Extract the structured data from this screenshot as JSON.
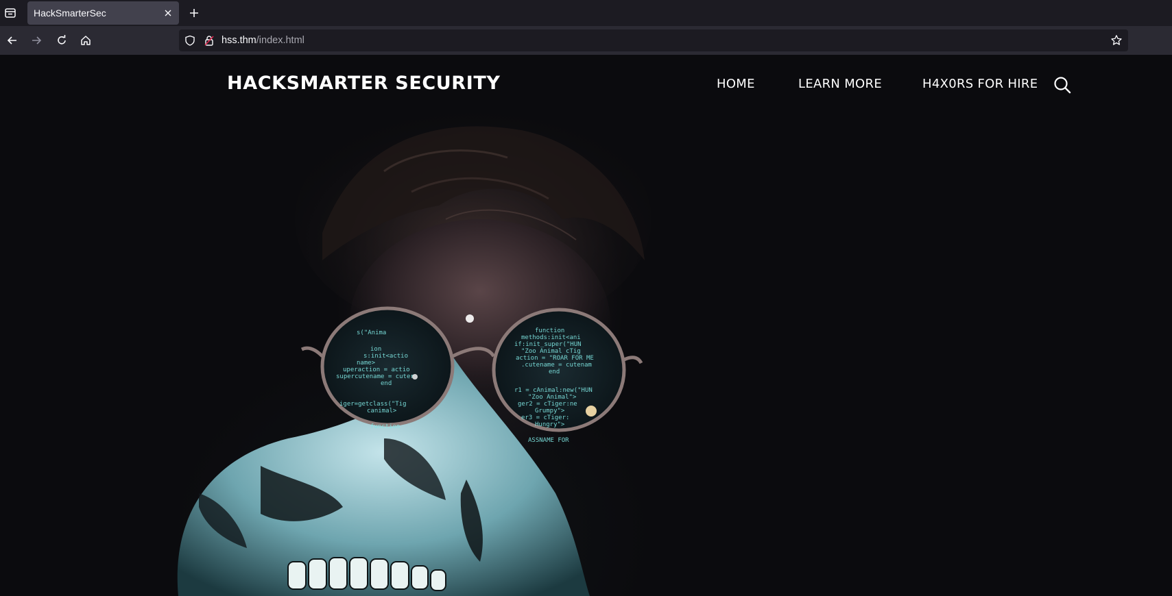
{
  "browser": {
    "tab": {
      "title": "HackSmarterSec"
    },
    "address": {
      "host": "hss.thm",
      "path": "/index.html"
    },
    "icons": {
      "tab_list": "tab-list-icon",
      "close": "close-icon",
      "new_tab": "plus-icon",
      "back": "back-arrow-icon",
      "forward": "forward-arrow-icon",
      "reload": "reload-icon",
      "home": "home-icon",
      "shield": "shield-icon",
      "lock": "lock-icon",
      "bookmark": "star-icon"
    }
  },
  "site": {
    "logo": "HACKSMARTER SECURITY",
    "nav": [
      {
        "label": "HOME"
      },
      {
        "label": "LEARN MORE"
      },
      {
        "label": "H4X0RS FOR HIRE"
      }
    ],
    "search_icon": "search-icon"
  },
  "colors": {
    "page_bg": "#0b0b0e",
    "tab_bar": "#1c1b22",
    "nav_bar": "#2b2a33",
    "active_tab": "#42414d",
    "code_glow": "#7fe8e4"
  }
}
